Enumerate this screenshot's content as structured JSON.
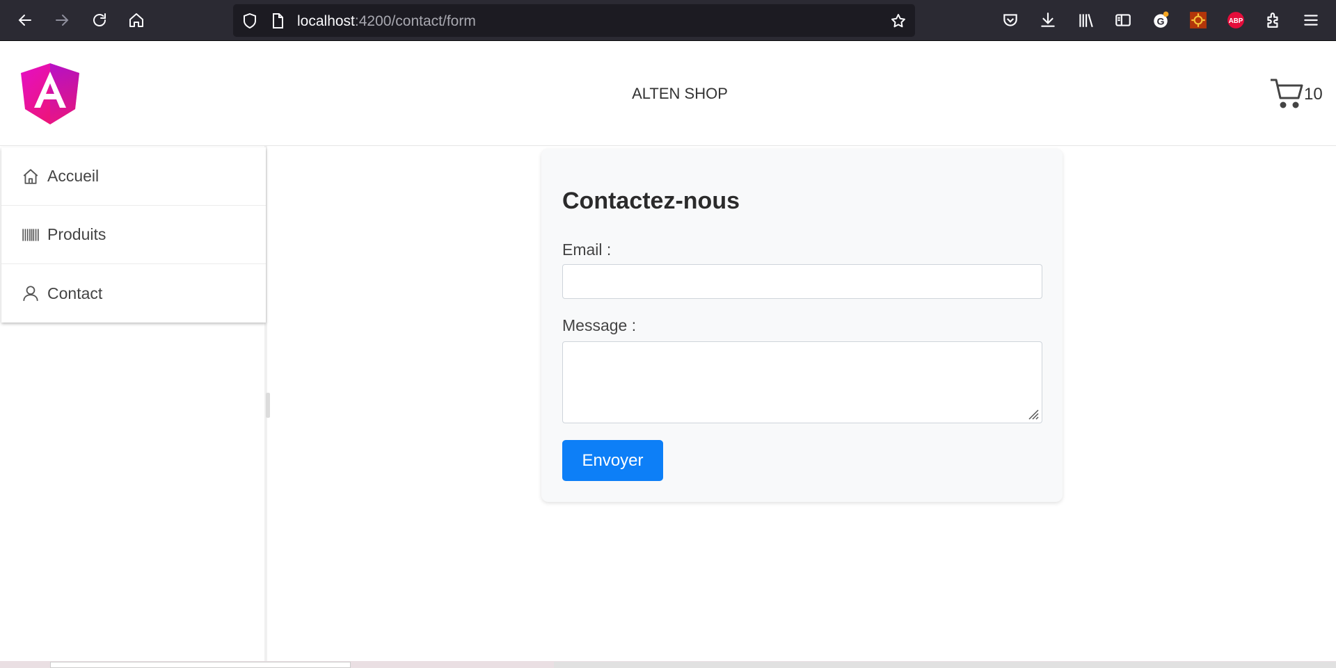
{
  "browser": {
    "url_host": "localhost",
    "url_rest": ":4200/contact/form"
  },
  "header": {
    "title": "ALTEN SHOP",
    "cart_count": "10"
  },
  "sidebar": {
    "items": [
      {
        "label": "Accueil",
        "icon": "home-icon"
      },
      {
        "label": "Produits",
        "icon": "barcode-icon"
      },
      {
        "label": "Contact",
        "icon": "user-icon"
      }
    ]
  },
  "form": {
    "heading": "Contactez-nous",
    "email_label": "Email :",
    "email_value": "",
    "message_label": "Message :",
    "message_value": "",
    "submit_label": "Envoyer"
  },
  "colors": {
    "primary": "#0d7ff7",
    "browser_bg": "#2b2a33",
    "card_bg": "#f8f9fa"
  }
}
